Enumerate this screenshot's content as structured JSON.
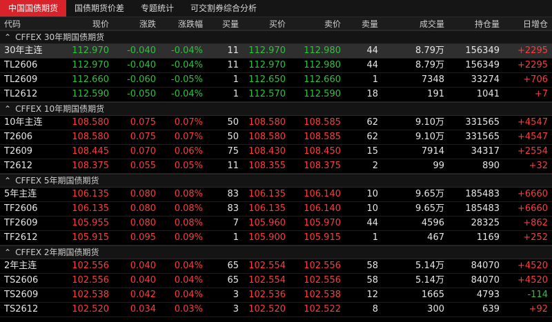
{
  "tabs": [
    {
      "label": "中国国债期货",
      "active": true
    },
    {
      "label": "国债期货价差",
      "active": false
    },
    {
      "label": "专题统计",
      "active": false
    },
    {
      "label": "可交割券综合分析",
      "active": false
    }
  ],
  "columns": [
    "代码",
    "现价",
    "涨跌",
    "涨跌幅",
    "买量",
    "买价",
    "卖价",
    "卖量",
    "成交量",
    "持仓量",
    "日增仓"
  ],
  "groups": [
    {
      "title": "CFFEX 30年期国债期货",
      "rows": [
        {
          "code": "30年主连",
          "price": "112.970",
          "change": "-0.040",
          "pct": "-0.04%",
          "bidvol": "11",
          "bid": "112.970",
          "ask": "112.980",
          "askvol": "44",
          "volume": "8.79万",
          "oi": "156349",
          "oichg": "+2295",
          "selected": true
        },
        {
          "code": "TL2606",
          "price": "112.970",
          "change": "-0.040",
          "pct": "-0.04%",
          "bidvol": "11",
          "bid": "112.970",
          "ask": "112.980",
          "askvol": "44",
          "volume": "8.79万",
          "oi": "156349",
          "oichg": "+2295"
        },
        {
          "code": "TL2609",
          "price": "112.660",
          "change": "-0.060",
          "pct": "-0.05%",
          "bidvol": "1",
          "bid": "112.650",
          "ask": "112.660",
          "askvol": "1",
          "volume": "7348",
          "oi": "33274",
          "oichg": "+706"
        },
        {
          "code": "TL2612",
          "price": "112.590",
          "change": "-0.050",
          "pct": "-0.04%",
          "bidvol": "1",
          "bid": "112.570",
          "ask": "112.590",
          "askvol": "18",
          "volume": "191",
          "oi": "1041",
          "oichg": "+7"
        }
      ]
    },
    {
      "title": "CFFEX 10年期国债期货",
      "rows": [
        {
          "code": "10年主连",
          "price": "108.580",
          "change": "0.075",
          "pct": "0.07%",
          "bidvol": "50",
          "bid": "108.580",
          "ask": "108.585",
          "askvol": "62",
          "volume": "9.10万",
          "oi": "331565",
          "oichg": "+4547"
        },
        {
          "code": "T2606",
          "price": "108.580",
          "change": "0.075",
          "pct": "0.07%",
          "bidvol": "50",
          "bid": "108.580",
          "ask": "108.585",
          "askvol": "62",
          "volume": "9.10万",
          "oi": "331565",
          "oichg": "+4547"
        },
        {
          "code": "T2609",
          "price": "108.445",
          "change": "0.070",
          "pct": "0.06%",
          "bidvol": "75",
          "bid": "108.430",
          "ask": "108.450",
          "askvol": "15",
          "volume": "7914",
          "oi": "34317",
          "oichg": "+2554"
        },
        {
          "code": "T2612",
          "price": "108.375",
          "change": "0.055",
          "pct": "0.05%",
          "bidvol": "11",
          "bid": "108.355",
          "ask": "108.375",
          "askvol": "2",
          "volume": "99",
          "oi": "890",
          "oichg": "+32"
        }
      ]
    },
    {
      "title": "CFFEX 5年期国债期货",
      "rows": [
        {
          "code": "5年主连",
          "price": "106.135",
          "change": "0.080",
          "pct": "0.08%",
          "bidvol": "83",
          "bid": "106.135",
          "ask": "106.140",
          "askvol": "10",
          "volume": "9.65万",
          "oi": "185483",
          "oichg": "+6660"
        },
        {
          "code": "TF2606",
          "price": "106.135",
          "change": "0.080",
          "pct": "0.08%",
          "bidvol": "83",
          "bid": "106.135",
          "ask": "106.140",
          "askvol": "10",
          "volume": "9.65万",
          "oi": "185483",
          "oichg": "+6660"
        },
        {
          "code": "TF2609",
          "price": "105.955",
          "change": "0.080",
          "pct": "0.08%",
          "bidvol": "7",
          "bid": "105.960",
          "ask": "105.970",
          "askvol": "44",
          "volume": "4596",
          "oi": "28325",
          "oichg": "+862"
        },
        {
          "code": "TF2612",
          "price": "105.915",
          "change": "0.095",
          "pct": "0.09%",
          "bidvol": "1",
          "bid": "105.900",
          "ask": "105.915",
          "askvol": "1",
          "volume": "467",
          "oi": "1169",
          "oichg": "+252"
        }
      ]
    },
    {
      "title": "CFFEX 2年期国债期货",
      "rows": [
        {
          "code": "2年主连",
          "price": "102.556",
          "change": "0.040",
          "pct": "0.04%",
          "bidvol": "65",
          "bid": "102.554",
          "ask": "102.556",
          "askvol": "58",
          "volume": "5.14万",
          "oi": "84070",
          "oichg": "+4520"
        },
        {
          "code": "TS2606",
          "price": "102.556",
          "change": "0.040",
          "pct": "0.04%",
          "bidvol": "65",
          "bid": "102.554",
          "ask": "102.556",
          "askvol": "58",
          "volume": "5.14万",
          "oi": "84070",
          "oichg": "+4520"
        },
        {
          "code": "TS2609",
          "price": "102.538",
          "change": "0.042",
          "pct": "0.04%",
          "bidvol": "3",
          "bid": "102.536",
          "ask": "102.538",
          "askvol": "12",
          "volume": "1665",
          "oi": "4793",
          "oichg": "-114"
        },
        {
          "code": "TS2612",
          "price": "102.520",
          "change": "0.034",
          "pct": "0.03%",
          "bidvol": "3",
          "bid": "102.520",
          "ask": "102.522",
          "askvol": "8",
          "volume": "300",
          "oi": "639",
          "oichg": "+92"
        }
      ]
    }
  ],
  "colors": {
    "up": "#ff3b3b",
    "down": "#2fc23d",
    "accent": "#d9232a"
  },
  "icons": {
    "group_caret": "caret-up-icon"
  }
}
